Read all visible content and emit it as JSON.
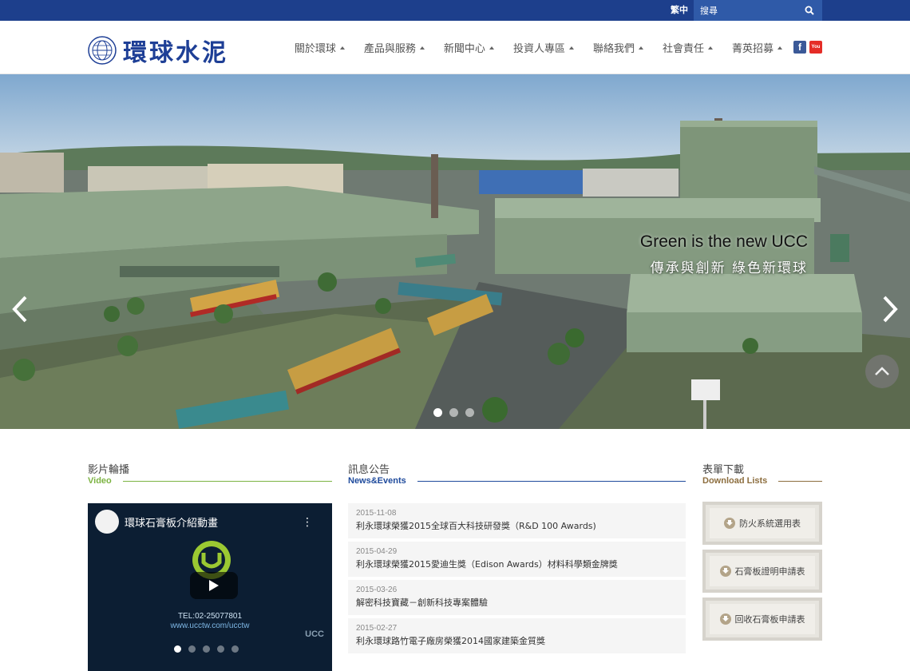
{
  "topbar": {
    "language": "繁中",
    "search_placeholder": "搜尋"
  },
  "header": {
    "logo_text": "環球水泥",
    "nav": [
      {
        "label": "關於環球"
      },
      {
        "label": "產品與服務"
      },
      {
        "label": "新聞中心"
      },
      {
        "label": "投資人專區"
      },
      {
        "label": "聯絡我們"
      },
      {
        "label": "社會責任"
      },
      {
        "label": "菁英招募"
      }
    ],
    "social": {
      "facebook": "f",
      "youtube": "You"
    }
  },
  "hero": {
    "caption_en": "Green is the new UCC",
    "caption_zh": "傳承與創新 綠色新環球",
    "slide_count": 3,
    "active_slide": 1
  },
  "video": {
    "title": "影片輪播",
    "subtitle": "Video",
    "video_title": "環球石膏板介紹動畫",
    "tel": "TEL:02-25077801",
    "url": "www.ucctw.com/ucctw",
    "logo_text": "UCC",
    "brand": "UCC",
    "dot_count": 5
  },
  "news": {
    "title": "訊息公告",
    "subtitle": "News&Events",
    "items": [
      {
        "date": "2015-11-08",
        "text": "利永環球榮獲2015全球百大科技研發獎（R&D 100 Awards)"
      },
      {
        "date": "2015-04-29",
        "text": "利永環球榮獲2015愛迪生獎（Edison Awards）材料科學類金牌獎"
      },
      {
        "date": "2015-03-26",
        "text": "解密科技寶藏－創新科技專案體驗"
      },
      {
        "date": "2015-02-27",
        "text": "利永環球路竹電子廠房榮獲2014國家建築金質獎"
      }
    ]
  },
  "downloads": {
    "title": "表單下載",
    "subtitle": "Download Lists",
    "items": [
      {
        "label": "防火系統選用表"
      },
      {
        "label": "石膏板證明申請表"
      },
      {
        "label": "回收石膏板申請表"
      }
    ]
  },
  "colors": {
    "topbar": "#1d3f8c",
    "logo": "#1e3f96",
    "video_accent": "#7cb342",
    "news_accent": "#1e4a9c",
    "download_accent": "#8d6e3f"
  }
}
